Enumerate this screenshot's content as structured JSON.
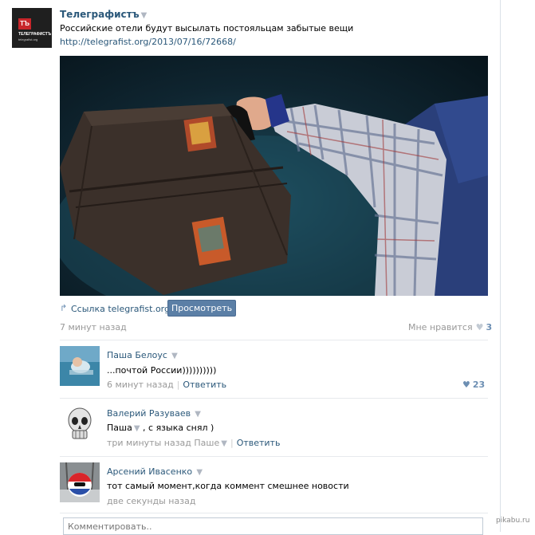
{
  "post": {
    "author": "Телеграфистъ",
    "text": "Российские отели будут высылать постояльцам забытые вещи",
    "url": "http://telegrafist.org/2013/07/16/72668/",
    "avatar": {
      "badge": "ТЪ",
      "name": "ТЕЛЕГРАФИСТЪ",
      "sub": "telegrafist.org"
    },
    "link_label": "Ссылка telegrafist.org",
    "view_button": "Просмотреть",
    "time": "7 минут назад",
    "likes_label": "Мне нравится",
    "likes_count": "3"
  },
  "comments": [
    {
      "author": "Паша Белоус",
      "text": "...почтой России))))))))))",
      "time": "6 минут назад",
      "reply": "Ответить",
      "likes": "23"
    },
    {
      "author": "Валерий Разуваев",
      "text": "Паша",
      "text_suffix": ", с языка снял )",
      "time": "три минуты назад",
      "mention": "Паше",
      "reply": "Ответить"
    },
    {
      "author": "Арсений Ивасенко",
      "text": "тот самый момент,когда коммент смешнее новости",
      "time": "две секунды назад"
    }
  ],
  "comment_input": {
    "placeholder": "Комментировать.."
  },
  "watermark": "pikabu.ru",
  "icons": {
    "caret": "caret-down-icon",
    "heart": "heart-icon",
    "link_arrow": "link-arrow-icon"
  },
  "colors": {
    "link": "#2b587a",
    "button": "#5b7fa6",
    "meta": "#999999"
  }
}
